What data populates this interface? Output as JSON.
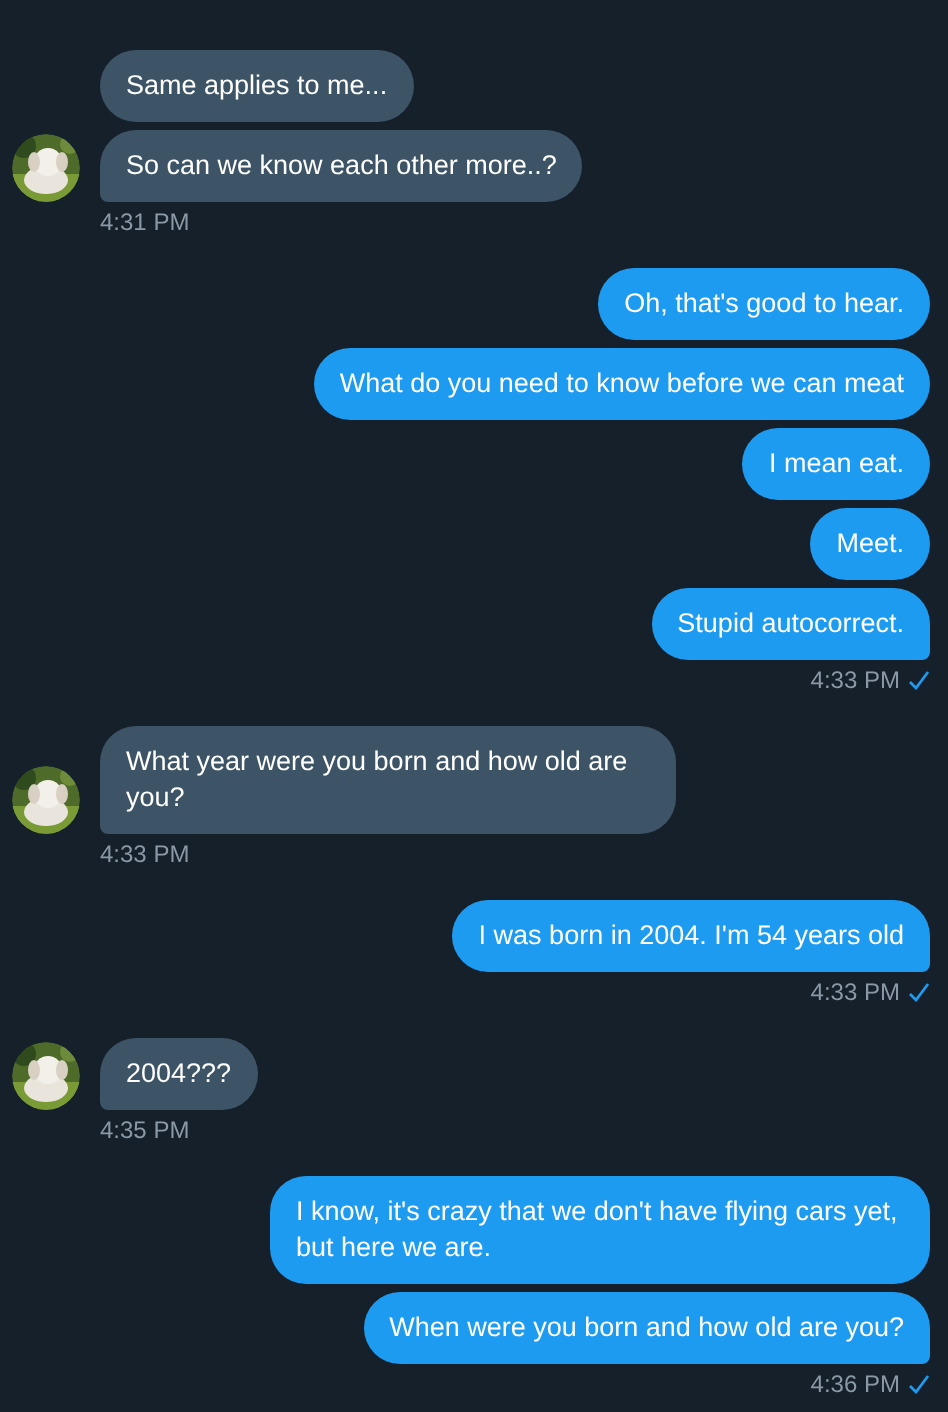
{
  "groups": [
    {
      "kind": "received",
      "messages": [
        "Same applies to me...",
        "So can we know each other more..?"
      ],
      "time": "4:31 PM"
    },
    {
      "kind": "sent",
      "messages": [
        "Oh, that's good to hear.",
        "What do you need to know before we can meat",
        "I mean eat.",
        "Meet.",
        "Stupid autocorrect."
      ],
      "time": "4:33 PM",
      "seen": true
    },
    {
      "kind": "received",
      "messages": [
        "What year were you born and how old are you?"
      ],
      "time": "4:33 PM"
    },
    {
      "kind": "sent",
      "messages": [
        "I was born in 2004. I'm 54 years old"
      ],
      "time": "4:33 PM",
      "seen": true
    },
    {
      "kind": "received",
      "messages": [
        "2004???"
      ],
      "time": "4:35 PM"
    },
    {
      "kind": "sent",
      "messages": [
        "I know, it's crazy that we don't have flying cars yet, but here we are.",
        "When were you born and how old are you?"
      ],
      "time": "4:36 PM",
      "seen": true
    }
  ]
}
